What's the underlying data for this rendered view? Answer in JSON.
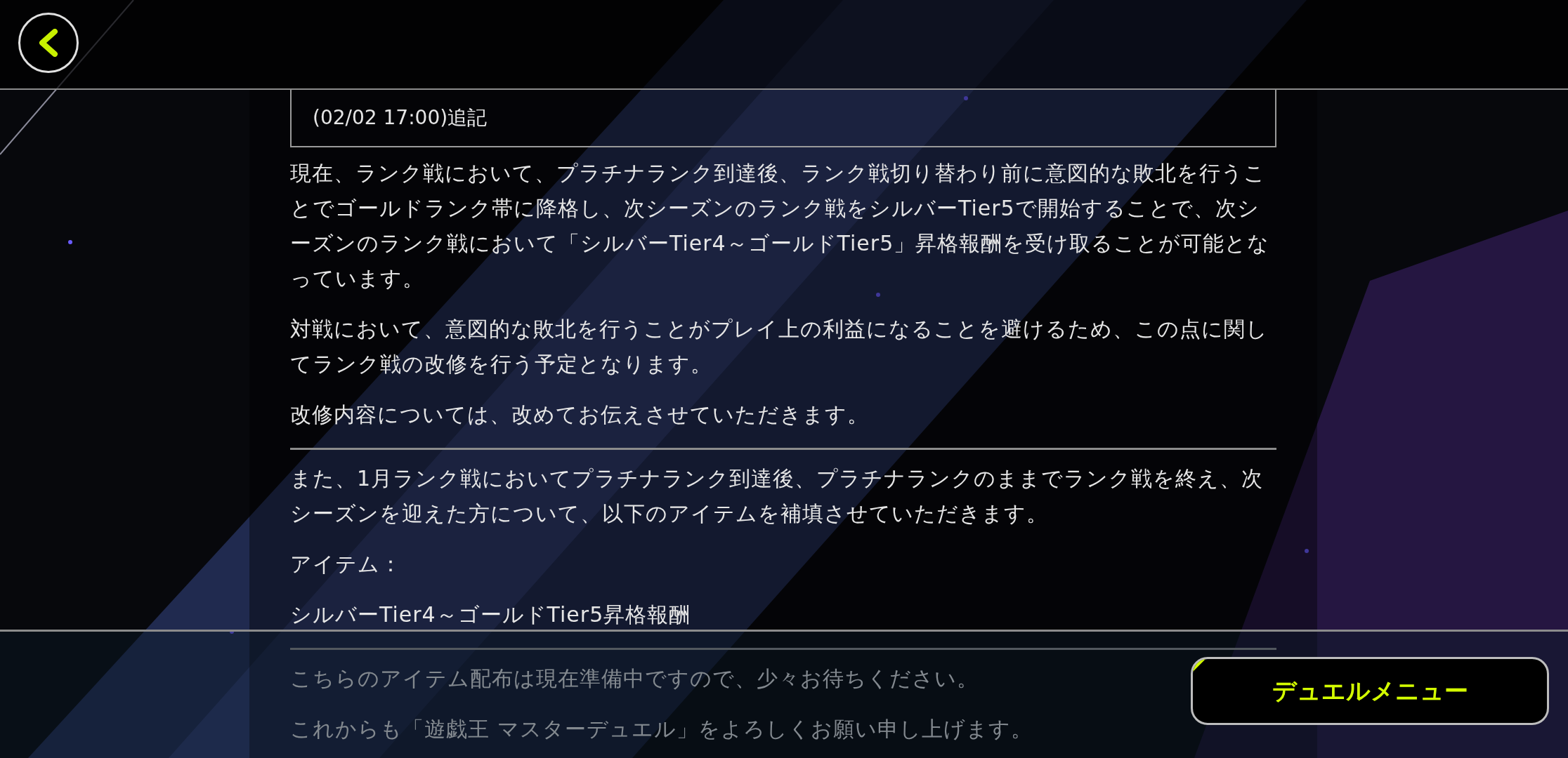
{
  "notice": {
    "heading": "(02/02 17:00)追記",
    "sections": [
      {
        "paragraphs": [
          "現在、ランク戦において、プラチナランク到達後、ランク戦切り替わり前に意図的な敗北を行うことでゴールドランク帯に降格し、次シーズンのランク戦をシルバーTier5で開始することで、次シーズンのランク戦において「シルバーTier4～ゴールドTier5」昇格報酬を受け取ることが可能となっています。",
          "対戦において、意図的な敗北を行うことがプレイ上の利益になることを避けるため、この点に関してランク戦の改修を行う予定となります。",
          "改修内容については、改めてお伝えさせていただきます。"
        ]
      },
      {
        "paragraphs": [
          "また、1月ランク戦においてプラチナランク到達後、プラチナランクのままでランク戦を終え、次シーズンを迎えた方について、以下のアイテムを補填させていただきます。",
          "アイテム：",
          "シルバーTier4～ゴールドTier5昇格報酬"
        ]
      },
      {
        "paragraphs": [
          "こちらのアイテム配布は現在準備中ですので、少々お待ちください。",
          "これからも「遊戯王 マスターデュエル」をよろしくお願い申し上げます。"
        ]
      }
    ]
  },
  "footer": {
    "button": "デュエルメニュー"
  }
}
